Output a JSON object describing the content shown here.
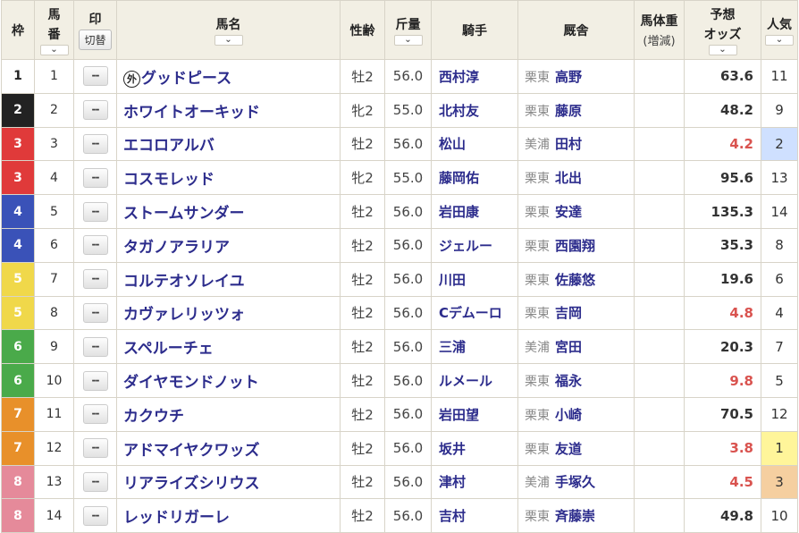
{
  "header": {
    "waku": "枠",
    "umaban_line1": "馬",
    "umaban_line2": "番",
    "mark_title": "印",
    "mark_toggle": "切替",
    "horse_name": "馬名",
    "sex_age": "性齢",
    "weight": "斤量",
    "jockey": "騎手",
    "stable": "厩舎",
    "body_weight_line1": "馬体重",
    "body_weight_line2": "(増減)",
    "odds_line1": "予想",
    "odds_line2": "オッズ",
    "popularity": "人気",
    "sort_icon": "⌄"
  },
  "colors": {
    "waku": {
      "1": "#ffffff",
      "2": "#222222",
      "3": "#e03a3a",
      "4": "#3a52b8",
      "5": "#f0d84a",
      "6": "#4aaa4a",
      "7": "#e8902a",
      "8": "#e58a9a"
    },
    "waku_text": {
      "1": "#222222",
      "2": "#ffffff",
      "3": "#ffffff",
      "4": "#ffffff",
      "5": "#ffffff",
      "6": "#ffffff",
      "7": "#ffffff",
      "8": "#ffffff"
    },
    "pop_highlight": {
      "1": "#fff59a",
      "2": "#cfe0ff",
      "3": "#f5cfa0"
    }
  },
  "mark_placeholder": "--",
  "foreign_mark": "外",
  "rows": [
    {
      "waku": "1",
      "umaban": "1",
      "foreign": true,
      "name": "グッドピース",
      "sexage": "牡2",
      "weight": "56.0",
      "jockey": "西村淳",
      "loc": "栗東",
      "trainer": "高野",
      "body": "",
      "odds": "63.6",
      "hot": false,
      "pop": "11"
    },
    {
      "waku": "2",
      "umaban": "2",
      "foreign": false,
      "name": "ホワイトオーキッド",
      "sexage": "牝2",
      "weight": "55.0",
      "jockey": "北村友",
      "loc": "栗東",
      "trainer": "藤原",
      "body": "",
      "odds": "48.2",
      "hot": false,
      "pop": "9"
    },
    {
      "waku": "3",
      "umaban": "3",
      "foreign": false,
      "name": "エコロアルバ",
      "sexage": "牡2",
      "weight": "56.0",
      "jockey": "松山",
      "loc": "美浦",
      "trainer": "田村",
      "body": "",
      "odds": "4.2",
      "hot": true,
      "pop": "2"
    },
    {
      "waku": "3",
      "umaban": "4",
      "foreign": false,
      "name": "コスモレッド",
      "sexage": "牝2",
      "weight": "55.0",
      "jockey": "藤岡佑",
      "loc": "栗東",
      "trainer": "北出",
      "body": "",
      "odds": "95.6",
      "hot": false,
      "pop": "13"
    },
    {
      "waku": "4",
      "umaban": "5",
      "foreign": false,
      "name": "ストームサンダー",
      "sexage": "牡2",
      "weight": "56.0",
      "jockey": "岩田康",
      "loc": "栗東",
      "trainer": "安達",
      "body": "",
      "odds": "135.3",
      "hot": false,
      "pop": "14"
    },
    {
      "waku": "4",
      "umaban": "6",
      "foreign": false,
      "name": "タガノアラリア",
      "sexage": "牡2",
      "weight": "56.0",
      "jockey": "ジェルー",
      "loc": "栗東",
      "trainer": "西園翔",
      "body": "",
      "odds": "35.3",
      "hot": false,
      "pop": "8"
    },
    {
      "waku": "5",
      "umaban": "7",
      "foreign": false,
      "name": "コルテオソレイユ",
      "sexage": "牡2",
      "weight": "56.0",
      "jockey": "川田",
      "loc": "栗東",
      "trainer": "佐藤悠",
      "body": "",
      "odds": "19.6",
      "hot": false,
      "pop": "6"
    },
    {
      "waku": "5",
      "umaban": "8",
      "foreign": false,
      "name": "カヴァレリッツォ",
      "sexage": "牡2",
      "weight": "56.0",
      "jockey": "Cデムーロ",
      "loc": "栗東",
      "trainer": "吉岡",
      "body": "",
      "odds": "4.8",
      "hot": true,
      "pop": "4"
    },
    {
      "waku": "6",
      "umaban": "9",
      "foreign": false,
      "name": "スペルーチェ",
      "sexage": "牡2",
      "weight": "56.0",
      "jockey": "三浦",
      "loc": "美浦",
      "trainer": "宮田",
      "body": "",
      "odds": "20.3",
      "hot": false,
      "pop": "7"
    },
    {
      "waku": "6",
      "umaban": "10",
      "foreign": false,
      "name": "ダイヤモンドノット",
      "sexage": "牡2",
      "weight": "56.0",
      "jockey": "ルメール",
      "loc": "栗東",
      "trainer": "福永",
      "body": "",
      "odds": "9.8",
      "hot": true,
      "pop": "5"
    },
    {
      "waku": "7",
      "umaban": "11",
      "foreign": false,
      "name": "カクウチ",
      "sexage": "牡2",
      "weight": "56.0",
      "jockey": "岩田望",
      "loc": "栗東",
      "trainer": "小崎",
      "body": "",
      "odds": "70.5",
      "hot": false,
      "pop": "12"
    },
    {
      "waku": "7",
      "umaban": "12",
      "foreign": false,
      "name": "アドマイヤクワッズ",
      "sexage": "牡2",
      "weight": "56.0",
      "jockey": "坂井",
      "loc": "栗東",
      "trainer": "友道",
      "body": "",
      "odds": "3.8",
      "hot": true,
      "pop": "1"
    },
    {
      "waku": "8",
      "umaban": "13",
      "foreign": false,
      "name": "リアライズシリウス",
      "sexage": "牡2",
      "weight": "56.0",
      "jockey": "津村",
      "loc": "美浦",
      "trainer": "手塚久",
      "body": "",
      "odds": "4.5",
      "hot": true,
      "pop": "3"
    },
    {
      "waku": "8",
      "umaban": "14",
      "foreign": false,
      "name": "レッドリガーレ",
      "sexage": "牡2",
      "weight": "56.0",
      "jockey": "吉村",
      "loc": "栗東",
      "trainer": "斉藤崇",
      "body": "",
      "odds": "49.8",
      "hot": false,
      "pop": "10"
    }
  ]
}
